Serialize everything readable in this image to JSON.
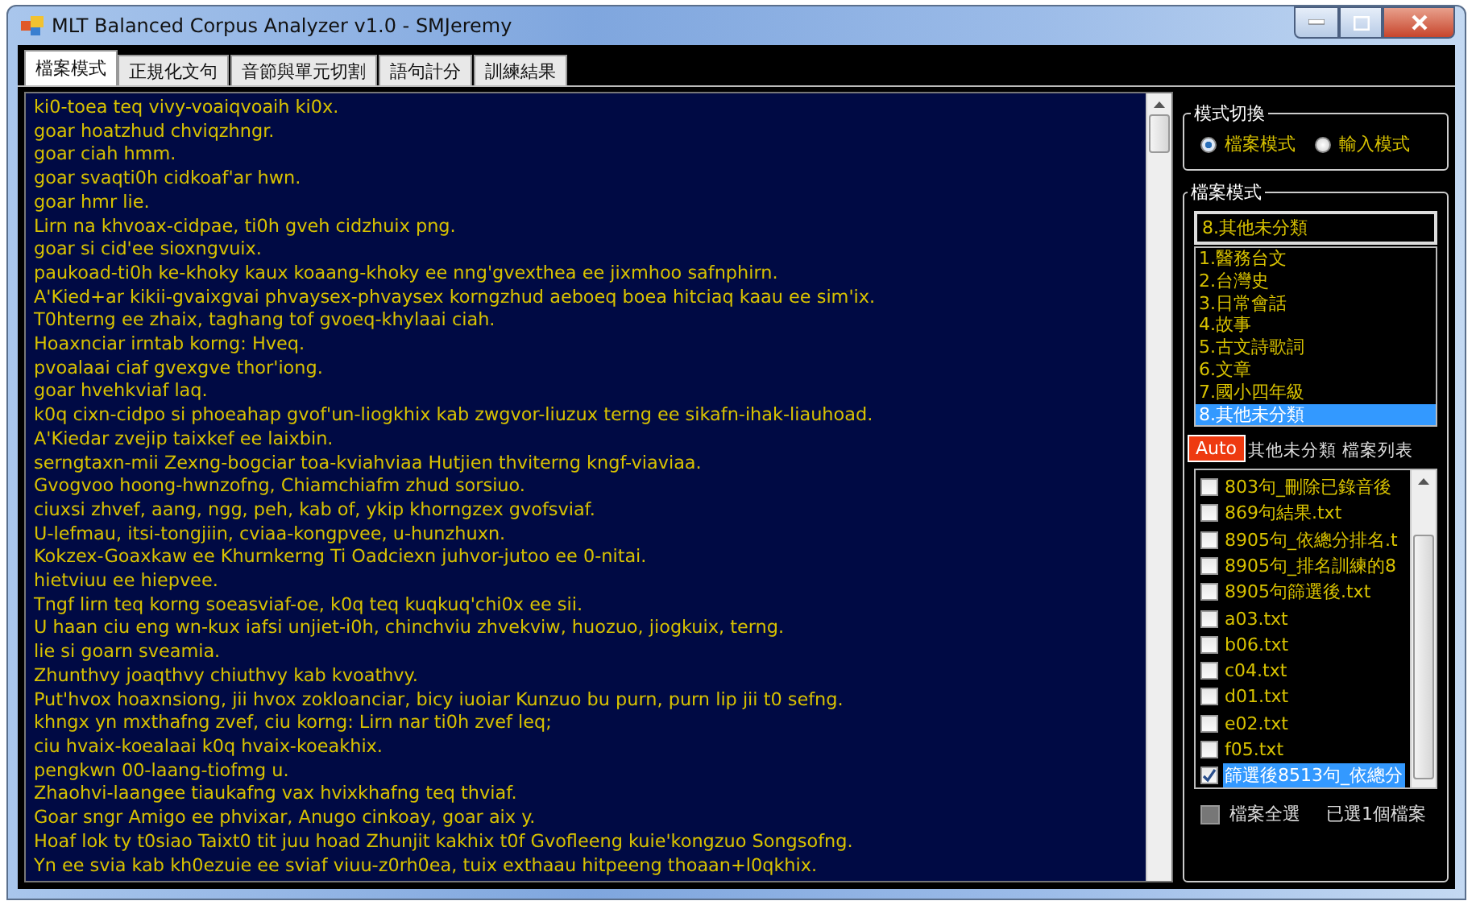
{
  "window": {
    "title": "MLT Balanced Corpus Analyzer v1.0 - SMJeremy"
  },
  "tabs": [
    {
      "label": "檔案模式",
      "selected": true
    },
    {
      "label": "正規化文句",
      "selected": false
    },
    {
      "label": "音節與單元切割",
      "selected": false
    },
    {
      "label": "語句計分",
      "selected": false
    },
    {
      "label": "訓練結果",
      "selected": false
    }
  ],
  "text_lines": [
    "ki0-toea teq vivy-voaiqvoaih ki0x.",
    "goar hoatzhud chviqzhngr.",
    "goar ciah hmm.",
    "goar svaqti0h cidkoaf'ar hwn.",
    "goar hmr lie.",
    "Lirn na khvoax-cidpae, ti0h gveh cidzhuix png.",
    "goar si cid'ee sioxngvuix.",
    "paukoad-ti0h ke-khoky kaux koaang-khoky ee nng'gvexthea ee jixmhoo safnphirn.",
    "A'Kied+ar kikii-gvaixgvai phvaysex-phvaysex korngzhud aeboeq boea hitciaq kaau ee sim'ix.",
    "T0hterng ee zhaix, taghang tof gvoeq-khylaai ciah.",
    "Hoaxnciar irntab korng: Hveq.",
    "pvoalaai ciaf gvexgve thor'iong.",
    "goar hvehkviaf laq.",
    "k0q cixn-cidpo si phoeahap gvof'un-liogkhix kab zwgvor-liuzux terng ee sikafn-ihak-liauhoad.",
    "A'Kiedar zvejip taixkef ee laixbin.",
    "serngtaxn-mii Zexng-bogciar toa-kviahviaa Hutjien thviterng kngf-viaviaa.",
    "Gvogvoo hoong-hwnzofng, Chiamchiafm zhud sorsiuo.",
    "ciuxsi zhvef, aang, ngg, peh, kab of, ykip khorngzex gvofsviaf.",
    "U-lefmau, itsi-tongjiin, cviaa-kongpvee, u-hunzhuxn.",
    "Kokzex-Goaxkaw ee Khurnkerng Ti Oadciexn juhvor-jutoo ee 0-nitai.",
    "hietviuu ee hiepvee.",
    "Tngf lirn teq korng soeasviaf-oe, k0q teq kuqkuq'chi0x ee sii.",
    "U haan ciu eng wn-kux iafsi unjiet-i0h, chinchviu zhvekviw, huozuo, jiogkuix, terng.",
    "lie si goarn sveamia.",
    "Zhunthvy joaqthvy chiuthvy kab kvoathvy.",
    "Put'hvox hoaxnsiong, jii hvox zokloanciar, bicy iuoiar Kunzuo bu purn, purn lip jii t0 sefng.",
    "khngx yn mxthafng zvef, ciu korng: Lirn nar ti0h zvef leq;",
    "ciu hvaix-koealaai k0q hvaix-koeakhix.",
    "pengkwn 00-laang-tiofmg u.",
    "Zhaohvi-laangee tiaukafng vax hvixkhafng teq thviaf.",
    "Goar sngr Amigo ee phvixar, Anugo cinkoay, goar aix y.",
    "Hoaf lok ty t0siao Taixt0 tit juu hoad Zhunjit kakhix t0f Gvofleeng kuie'kongzuo Songsofng.",
    "Yn ee svia kab kh0ezuie ee sviaf viuu-z0rh0ea, tuix exthaau hitpeeng thoaan+l0qkhix."
  ],
  "mode_switch": {
    "title": "模式切換",
    "options": [
      {
        "label": "檔案模式",
        "selected": true
      },
      {
        "label": "輸入模式",
        "selected": false
      }
    ]
  },
  "file_mode": {
    "title": "檔案模式",
    "category_value": "8.其他未分類",
    "categories": [
      {
        "label": "1.醫務台文",
        "selected": false
      },
      {
        "label": "2.台灣史",
        "selected": false
      },
      {
        "label": "3.日常會話",
        "selected": false
      },
      {
        "label": "4.故事",
        "selected": false
      },
      {
        "label": "5.古文詩歌詞",
        "selected": false
      },
      {
        "label": "6.文章",
        "selected": false
      },
      {
        "label": "7.國小四年級",
        "selected": false
      },
      {
        "label": "8.其他未分類",
        "selected": true
      }
    ],
    "auto_button": "Auto",
    "list_label": "其他未分類 檔案列表",
    "files": [
      {
        "name": "803句_刪除已錄音後",
        "checked": false,
        "selected": false
      },
      {
        "name": "869句結果.txt",
        "checked": false,
        "selected": false
      },
      {
        "name": "8905句_依總分排名.t",
        "checked": false,
        "selected": false
      },
      {
        "name": "8905句_排名訓練的8",
        "checked": false,
        "selected": false
      },
      {
        "name": "8905句篩選後.txt",
        "checked": false,
        "selected": false
      },
      {
        "name": "a03.txt",
        "checked": false,
        "selected": false
      },
      {
        "name": "b06.txt",
        "checked": false,
        "selected": false
      },
      {
        "name": "c04.txt",
        "checked": false,
        "selected": false
      },
      {
        "name": "d01.txt",
        "checked": false,
        "selected": false
      },
      {
        "name": "e02.txt",
        "checked": false,
        "selected": false
      },
      {
        "name": "f05.txt",
        "checked": false,
        "selected": false
      },
      {
        "name": "篩選後8513句_依總分",
        "checked": true,
        "selected": true
      }
    ],
    "select_all": {
      "label": "檔案全選",
      "checked": false
    },
    "selected_count": "已選1個檔案"
  }
}
